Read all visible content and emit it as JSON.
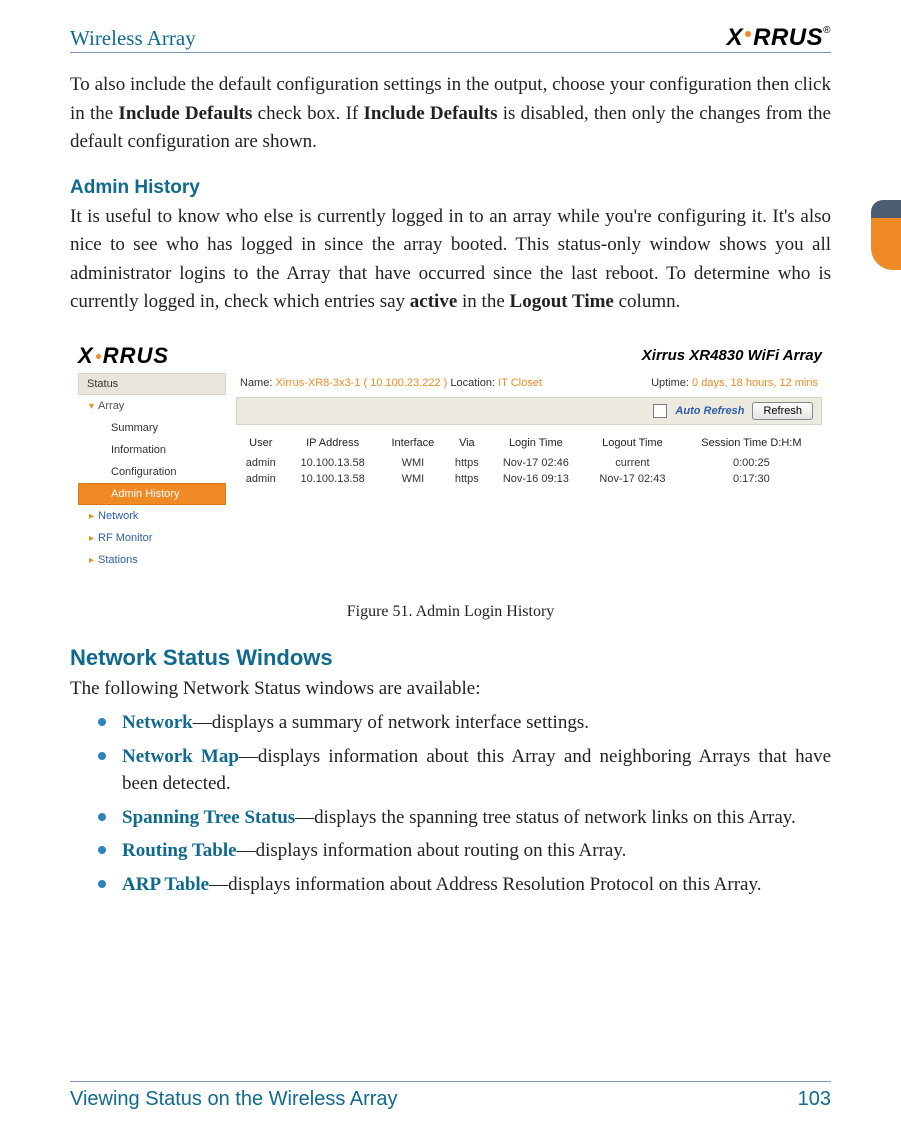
{
  "header": {
    "title": "Wireless Array",
    "brand": "XIRRUS"
  },
  "intro": {
    "pre": "To also include the default configuration settings in the output, choose your configuration then click in the ",
    "b1": "Include Defaults",
    "mid1": " check box. If ",
    "b2": "Include Defaults",
    "post": " is disabled, then only the changes from the default configuration are shown."
  },
  "admin_history": {
    "heading": "Admin History",
    "p_pre": "It is useful to know who else is currently logged in to an array while you're configuring it. It's also nice to see who has logged in since the array booted. This status-only window shows you all administrator logins to the Array that have occurred since the last reboot. To determine who is currently logged in, check which entries say ",
    "b1": "active",
    "mid": " in the ",
    "b2": "Logout Time",
    "post": " column."
  },
  "figure": {
    "brand": "XIRRUS",
    "product_line": "Xirrus XR4830 WiFi Array",
    "meta": {
      "name_label": "Name:",
      "name_value": "Xirrus-XR8-3x3-1",
      "ip_value": "( 10.100.23.222 )",
      "loc_label": "Location:",
      "loc_value": "IT Closet",
      "uptime_label": "Uptime:",
      "uptime_value": "0 days, 18 hours, 12 mins"
    },
    "nav": {
      "head": "Status",
      "array": "Array",
      "summary": "Summary",
      "information": "Information",
      "configuration": "Configuration",
      "admin_history": "Admin History",
      "network": "Network",
      "rf_monitor": "RF Monitor",
      "stations": "Stations"
    },
    "bar": {
      "auto_refresh": "Auto Refresh",
      "refresh": "Refresh"
    },
    "table": {
      "columns": [
        "User",
        "IP Address",
        "Interface",
        "Via",
        "Login Time",
        "Logout Time",
        "Session Time D:H:M"
      ],
      "rows": [
        {
          "c": [
            "admin",
            "10.100.13.58",
            "WMI",
            "https",
            "Nov-17 02:46",
            "current",
            "0:00:25"
          ]
        },
        {
          "c": [
            "admin",
            "10.100.13.58",
            "WMI",
            "https",
            "Nov-16 09:13",
            "Nov-17 02:43",
            "0:17:30"
          ]
        }
      ]
    },
    "caption": "Figure 51. Admin Login History"
  },
  "network_status": {
    "heading": "Network Status Windows",
    "intro": "The following Network Status windows are available:",
    "items": [
      {
        "link": "Network",
        "text": "—displays a summary of network interface settings."
      },
      {
        "link": "Network Map",
        "text": "—displays information about this Array and neighboring Arrays that have been detected."
      },
      {
        "link": "Spanning Tree Status",
        "text": "—displays the spanning tree status of network links on this Array."
      },
      {
        "link": "Routing Table",
        "text": "—displays information about routing on this Array."
      },
      {
        "link": "ARP Table",
        "text": "—displays information about Address Resolution Protocol on this Array."
      }
    ]
  },
  "footer": {
    "left": "Viewing Status on the Wireless Array",
    "right": "103"
  }
}
